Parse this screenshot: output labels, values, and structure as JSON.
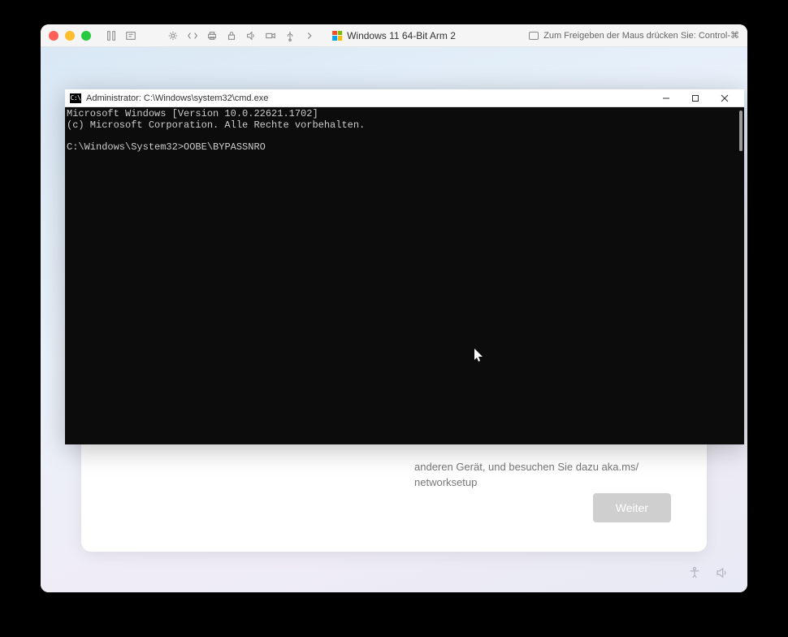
{
  "mac": {
    "vm_title": "Windows 11 64-Bit Arm 2",
    "release_hint": "Zum Freigeben der Maus drücken Sie: Control-⌘"
  },
  "oobe": {
    "partial_text_line1": "anderen Gerät, und besuchen Sie dazu aka.ms/",
    "partial_text_line2": "networksetup",
    "next_button": "Weiter"
  },
  "cmd": {
    "title": "Administrator: C:\\Windows\\system32\\cmd.exe",
    "line1": "Microsoft Windows [Version 10.0.22621.1702]",
    "line2": "(c) Microsoft Corporation. Alle Rechte vorbehalten.",
    "blank": "",
    "prompt": "C:\\Windows\\System32>",
    "typed": "OOBE\\BYPASSNRO"
  }
}
